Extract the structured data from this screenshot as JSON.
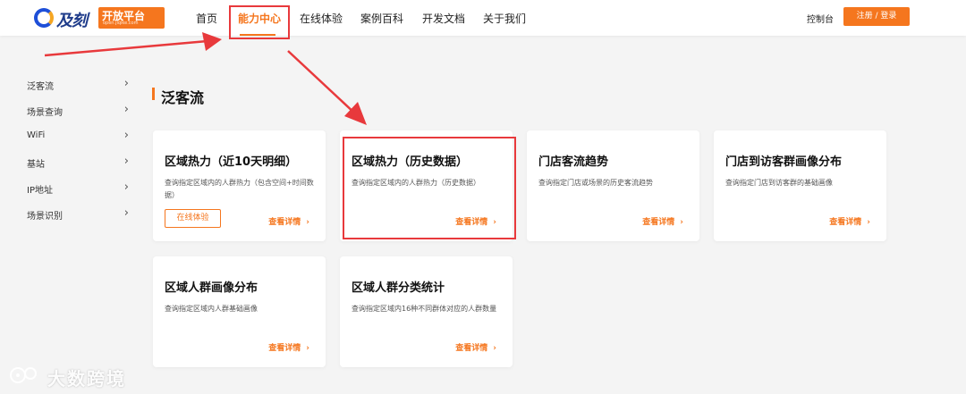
{
  "brand": {
    "name": "及刻",
    "badge": "开放平台",
    "badge_sub": "open.jiqike.com",
    "primary_color": "#f5761e",
    "logo_blue": "#1e4fd8"
  },
  "nav": {
    "items": [
      "首页",
      "能力中心",
      "在线体验",
      "案例百科",
      "开发文档",
      "关于我们"
    ],
    "active": "能力中心"
  },
  "header_right": {
    "console": "控制台",
    "login": "注册 / 登录"
  },
  "sidebar": {
    "items": [
      "泛客流",
      "场景查询",
      "WiFi",
      "基站",
      "IP地址",
      "场景识别"
    ]
  },
  "section": {
    "title": "泛客流"
  },
  "cards": [
    {
      "title": "区域热力（近10天明细）",
      "desc": "查询指定区域内的人群热力（包含空间+时间数据）",
      "link": "查看详情",
      "try": "在线体验"
    },
    {
      "title": "区域热力（历史数据）",
      "desc": "查询指定区域内的人群热力（历史数据）",
      "link": "查看详情"
    },
    {
      "title": "门店客流趋势",
      "desc": "查询指定门店或场景的历史客流趋势",
      "link": "查看详情"
    },
    {
      "title": "门店到访客群画像分布",
      "desc": "查询指定门店到访客群的基础画像",
      "link": "查看详情"
    },
    {
      "title": "区域人群画像分布",
      "desc": "查询指定区域内人群基础画像",
      "link": "查看详情"
    },
    {
      "title": "区域人群分类统计",
      "desc": "查询指定区域内16种不同群体对应的人群数量",
      "link": "查看详情"
    }
  ],
  "annotation_color": "#e8393c",
  "watermark": {
    "text": "大数跨境"
  }
}
